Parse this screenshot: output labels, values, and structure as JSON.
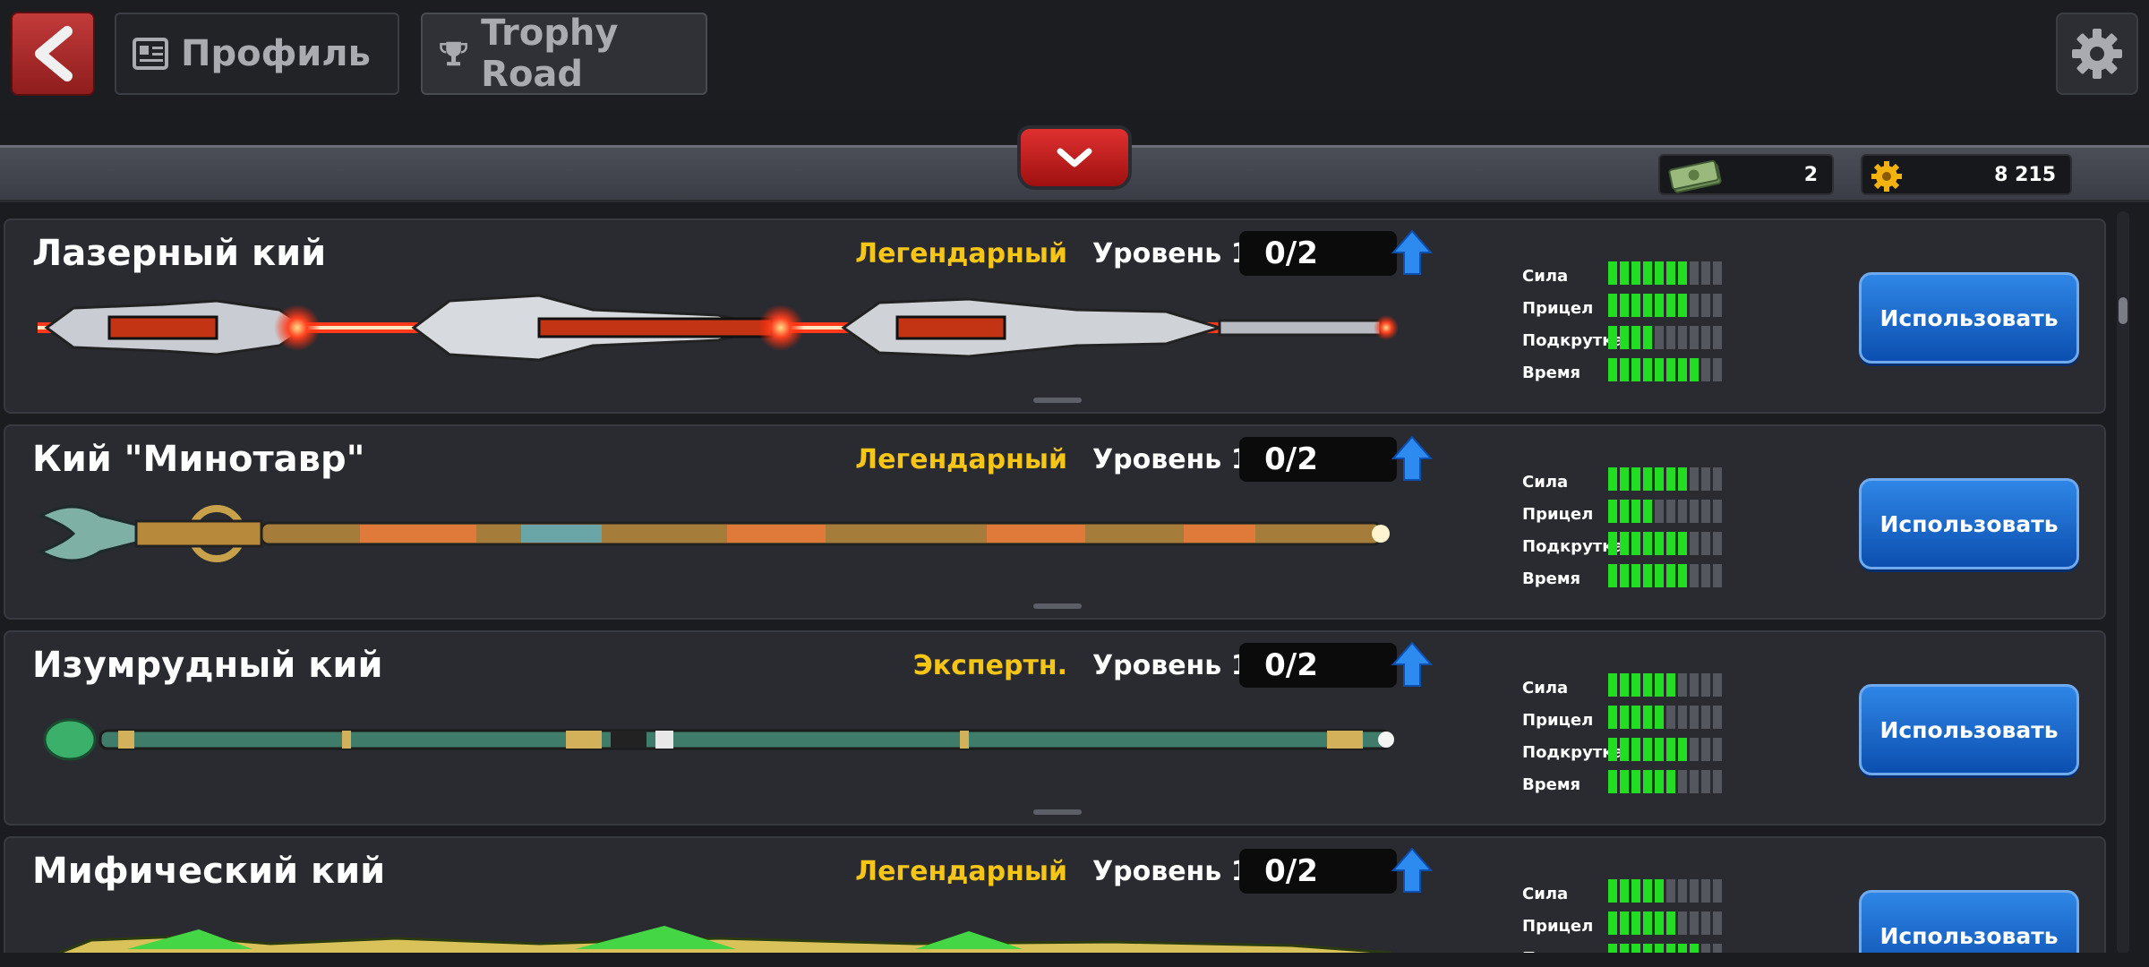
{
  "topbar": {
    "profile_label": "Профиль",
    "trophy_label": "Trophy Road"
  },
  "currencies": {
    "cash": "2",
    "coins": "8 215"
  },
  "stat_labels": {
    "power": "Сила",
    "aim": "Прицел",
    "spin": "Подкрутка",
    "time": "Время"
  },
  "cues": [
    {
      "name": "Лазерный кий",
      "rarity": "Легендарный",
      "level": "Уровень 1",
      "progress": "0/2",
      "stats": {
        "power": 7,
        "aim": 7,
        "spin": 4,
        "time": 8
      },
      "button": "Использовать",
      "style": "laser"
    },
    {
      "name": "Кий \"Минотавр\"",
      "rarity": "Легендарный",
      "level": "Уровень 1",
      "progress": "0/2",
      "stats": {
        "power": 7,
        "aim": 4,
        "spin": 7,
        "time": 7
      },
      "button": "Использовать",
      "style": "minotaur"
    },
    {
      "name": "Изумрудный кий",
      "rarity": "Экспертн.",
      "level": "Уровень 1",
      "progress": "0/2",
      "stats": {
        "power": 6,
        "aim": 5,
        "spin": 7,
        "time": 6
      },
      "button": "Использовать",
      "style": "emerald"
    },
    {
      "name": "Мифический кий",
      "rarity": "Легендарный",
      "level": "Уровень 1",
      "progress": "0/2",
      "stats": {
        "power": 5,
        "aim": 6,
        "spin": 8
      },
      "button": "Использовать",
      "style": "mythic"
    }
  ],
  "colors": {
    "rarity": "#f5c518",
    "stat_on": "#22dd22",
    "stat_off": "#55575e",
    "button": "#1565d8",
    "back": "#b52a2a"
  }
}
